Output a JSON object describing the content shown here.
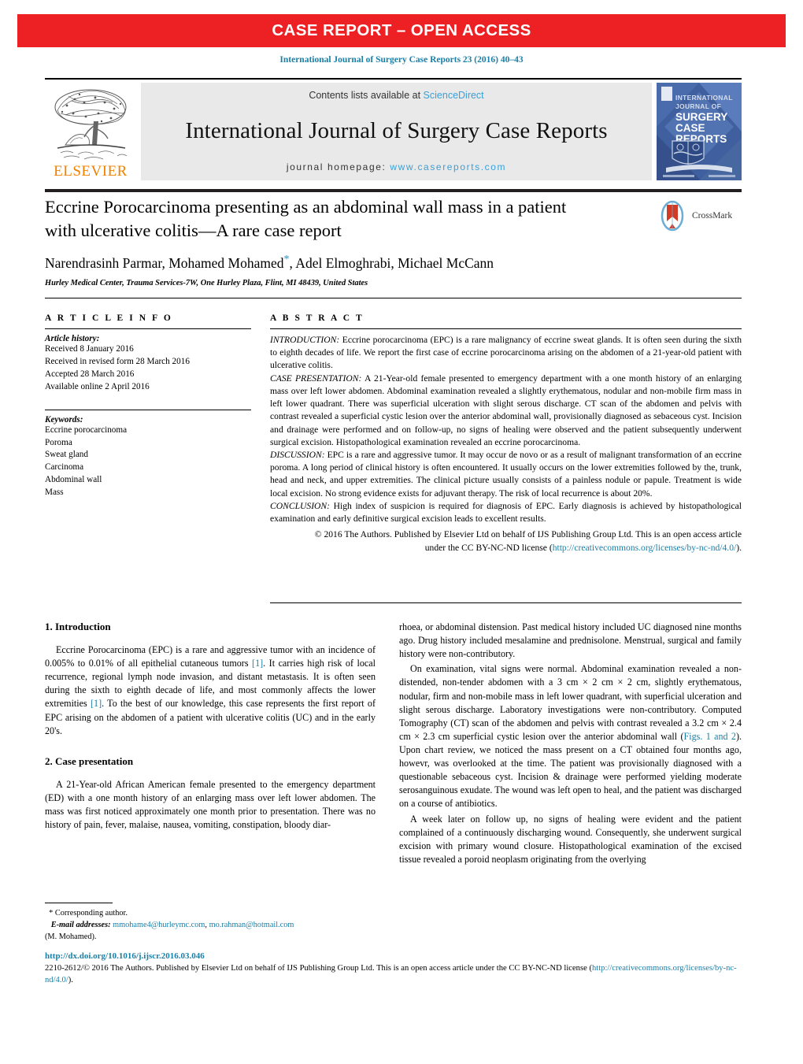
{
  "banner": {
    "text": "CASE REPORT – OPEN ACCESS",
    "color": "#ed2024"
  },
  "running_head": "International Journal of Surgery Case Reports 23 (2016) 40–43",
  "masthead": {
    "publisher_name": "ELSEVIER",
    "publisher_logo_icon": "elsevier-tree-icon",
    "contents_prefix": "Contents lists available at",
    "contents_link": "ScienceDirect",
    "journal_title": "International Journal of Surgery Case Reports",
    "homepage_prefix": "journal homepage:",
    "homepage_url": "www.casereports.com",
    "cover_lines": [
      "INTERNATIONAL",
      "JOURNAL OF",
      "SURGERY",
      "CASE",
      "REPORTS"
    ]
  },
  "article": {
    "title": "Eccrine Porocarcinoma presenting as an abdominal wall mass in a patient with ulcerative colitis—A rare case report",
    "authors_before_star": "Narendrasinh Parmar, Mohamed Mohamed",
    "author_star": "*",
    "authors_after_star": ", Adel Elmoghrabi, Michael McCann",
    "affiliation": "Hurley Medical Center, Trauma Services-7W, One Hurley Plaza, Flint, MI 48439, United States",
    "crossmark_label": "CrossMark"
  },
  "article_info": {
    "heading": "A R T I C L E   I N F O",
    "history_label": "Article history:",
    "history": [
      "Received 8 January 2016",
      "Received in revised form 28 March 2016",
      "Accepted 28 March 2016",
      "Available online 2 April 2016"
    ],
    "keywords_label": "Keywords:",
    "keywords": [
      "Eccrine porocarcinoma",
      "Poroma",
      "Sweat gland",
      "Carcinoma",
      "Abdominal wall",
      "Mass"
    ]
  },
  "abstract": {
    "heading": "A B S T R A C T",
    "introduction_label": "INTRODUCTION:",
    "introduction_text": " Eccrine porocarcinoma (EPC) is a rare malignancy of eccrine sweat glands. It is often seen during the sixth to eighth decades of life. We report the first case of eccrine porocarcinoma arising on the abdomen of a 21-year-old patient with ulcerative colitis.",
    "case_label": "CASE PRESENTATION:",
    "case_text": " A 21-Year-old female presented to emergency department with a one month history of an enlarging mass over left lower abdomen. Abdominal examination revealed a slightly erythematous, nodular and non-mobile firm mass in left lower quadrant. There was superficial ulceration with slight serous discharge. CT scan of the abdomen and pelvis with contrast revealed a superficial cystic lesion over the anterior abdominal wall, provisionally diagnosed as sebaceous cyst. Incision and drainage were performed and on follow-up, no signs of healing were observed and the patient subsequently underwent surgical excision. Histopathological examination revealed an eccrine porocarcinoma.",
    "discussion_label": "DISCUSSION:",
    "discussion_text": " EPC is a rare and aggressive tumor. It may occur de novo or as a result of malignant transformation of an eccrine poroma. A long period of clinical history is often encountered. It usually occurs on the lower extremities followed by the, trunk, head and neck, and upper extremities. The clinical picture usually consists of a painless nodule or papule. Treatment is wide local excision. No strong evidence exists for adjuvant therapy. The risk of local recurrence is about 20%.",
    "conclusion_label": "CONCLUSION:",
    "conclusion_text": " High index of suspicion is required for diagnosis of EPC. Early diagnosis is achieved by histopathological examination and early definitive surgical excision leads to excellent results.",
    "copyright_text": "© 2016 The Authors. Published by Elsevier Ltd on behalf of IJS Publishing Group Ltd. This is an open access article under the CC BY-NC-ND license (",
    "copyright_link": "http://creativecommons.org/licenses/by-nc-nd/4.0/",
    "copyright_tail": ")."
  },
  "body": {
    "left": {
      "section1_heading": "1.  Introduction",
      "section1_p1_a": "Eccrine Porocarcinoma (EPC) is a rare and aggressive tumor with an incidence of 0.005% to 0.01% of all epithelial cutaneous tumors ",
      "section1_ref1": "[1]",
      "section1_p1_b": ". It carries high risk of local recurrence, regional lymph node invasion, and distant metastasis. It is often seen during the sixth to eighth decade of life, and most commonly affects the lower extremities ",
      "section1_ref2": "[1]",
      "section1_p1_c": ". To the best of our knowledge, this case represents the first report of EPC arising on the abdomen of a patient with ulcerative colitis (UC) and in the early 20's.",
      "section2_heading": "2.  Case presentation",
      "section2_p1": "A 21-Year-old African American female presented to the emergency department (ED) with a one month history of an enlarging mass over left lower abdomen. The mass was first noticed approximately one month prior to presentation. There was no history of pain, fever, malaise, nausea, vomiting, constipation, bloody diar-"
    },
    "right": {
      "p1": "rhoea, or abdominal distension. Past medical history included UC diagnosed nine months ago. Drug history included mesalamine and prednisolone. Menstrual, surgical and family history were non-contributory.",
      "p2": "On examination, vital signs were normal. Abdominal examination revealed a non-distended, non-tender abdomen with a 3 cm × 2 cm × 2 cm, slightly erythematous, nodular, firm and non-mobile mass in left lower quadrant, with superficial ulceration and slight serous discharge. Laboratory investigations were non-contributory. Computed Tomography (CT) scan of the abdomen and pelvis with contrast revealed a 3.2 cm × 2.4 cm × 2.3 cm superficial cystic lesion over the anterior abdominal wall (",
      "p2_figlink": "Figs. 1 and 2",
      "p2_b": "). Upon chart review, we noticed the mass present on a CT obtained four months ago, howevr, was overlooked at the time. The patient was provisionally diagnosed with a questionable sebaceous cyst. Incision & drainage were performed yielding moderate serosanguinous exudate. The wound was left open to heal, and the patient was discharged on a course of antibiotics.",
      "p3": "A week later on follow up, no signs of healing were evident and the patient complained of a continuously discharging wound. Consequently, she underwent surgical excision with primary wound closure. Histopathological examination of the excised tissue revealed a poroid neoplasm originating from the overlying"
    }
  },
  "footnote": {
    "star": "*",
    "corresponding": " Corresponding author.",
    "email_label": "E-mail addresses:",
    "email1": "mmohame4@hurleymc.com",
    "email_sep": ", ",
    "email2": "mo.rahman@hotmail.com",
    "email_owner": "(M. Mohamed)."
  },
  "footer": {
    "doi": "http://dx.doi.org/10.1016/j.ijscr.2016.03.046",
    "issn_text": "2210-2612/© 2016 The Authors. Published by Elsevier Ltd on behalf of IJS Publishing Group Ltd. This is an open access article under the CC BY-NC-ND license (",
    "license_link": "http://creativecommons.org/licenses/by-nc-nd/4.0/",
    "tail": ")."
  }
}
